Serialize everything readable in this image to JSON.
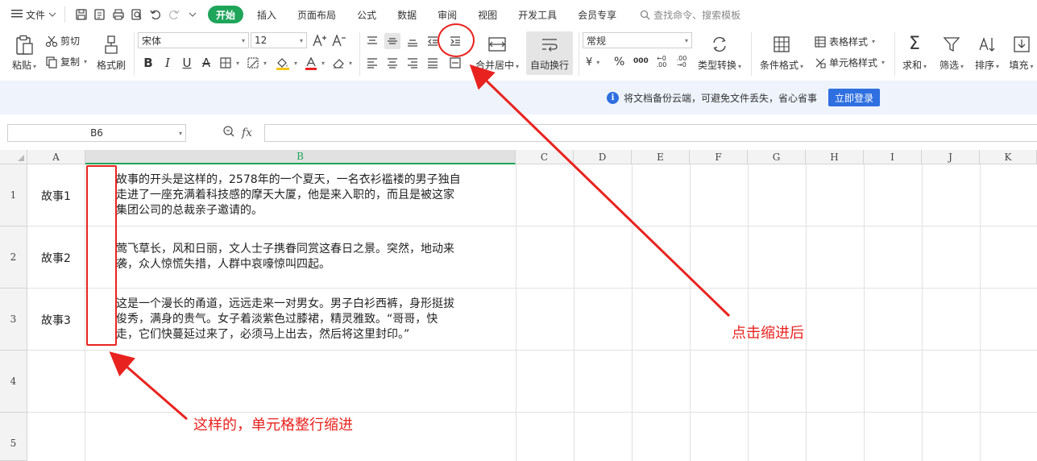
{
  "menubar": {
    "file_label": "文件",
    "tabs": [
      {
        "label": "开始",
        "active": true
      },
      {
        "label": "插入"
      },
      {
        "label": "页面布局"
      },
      {
        "label": "公式"
      },
      {
        "label": "数据"
      },
      {
        "label": "审阅"
      },
      {
        "label": "视图"
      },
      {
        "label": "开发工具"
      },
      {
        "label": "会员专享"
      }
    ],
    "search_placeholder": "查找命令、搜索模板"
  },
  "ribbon": {
    "paste": "粘贴",
    "cut": "剪切",
    "copy": "复制",
    "format_painter": "格式刷",
    "font_name": "宋体",
    "font_size": "12",
    "merge_center": "合并居中",
    "wrap_text": "自动换行",
    "number_format": "常规",
    "type_convert": "类型转换",
    "conditional_format": "条件格式",
    "table_style": "表格样式",
    "cell_style": "单元格样式",
    "sum": "求和",
    "filter": "筛选",
    "sort": "排序",
    "fill": "填充",
    "percent": "%",
    "thousands": "000",
    "currency": "¥",
    "dec_increase": "←0 .00",
    "dec_decrease": ".00 →0"
  },
  "notice": {
    "text": "将文档备份云端，可避免文件丢失，省心省事",
    "button": "立即登录"
  },
  "formula_bar": {
    "cell_ref": "B6",
    "fx": "fx",
    "value": ""
  },
  "sheet": {
    "columns": [
      "A",
      "B",
      "C",
      "D",
      "E",
      "F",
      "G",
      "H",
      "I",
      "J",
      "K"
    ],
    "selected_column": "B",
    "rows": [
      "1",
      "2",
      "3",
      "4",
      "5"
    ],
    "cells": [
      {
        "a": "故事1",
        "b_lines": [
          "故事的开头是这样的，2578年的一个夏天，一名衣衫褴褛的男子独自",
          "走进了一座充满着科技感的摩天大厦，他是来入职的，而且是被这家",
          "集团公司的总裁亲子邀请的。"
        ]
      },
      {
        "a": "故事2",
        "b_lines": [
          "莺飞草长，风和日丽，文人士子携眷同赏这春日之景。突然，地动来",
          "袭，众人惊慌失措，人群中哀嚎惊叫四起。"
        ]
      },
      {
        "a": "故事3",
        "b_lines": [
          "这是一个漫长的甬道，远远走来一对男女。男子白衫西裤，身形挺拔",
          "俊秀，满身的贵气。女子着淡紫色过膝裙，精灵雅致。“哥哥，快",
          "走，它们快蔓延过来了，必须马上出去，然后将这里封印。”"
        ]
      }
    ]
  },
  "annotations": {
    "after_click": "点击缩进后",
    "whole_indent": "这样的，单元格整行缩进"
  },
  "colors": {
    "accent_green": "#1ea55a",
    "annotation_red": "#e8231f",
    "login_blue": "#2f6fe0"
  }
}
